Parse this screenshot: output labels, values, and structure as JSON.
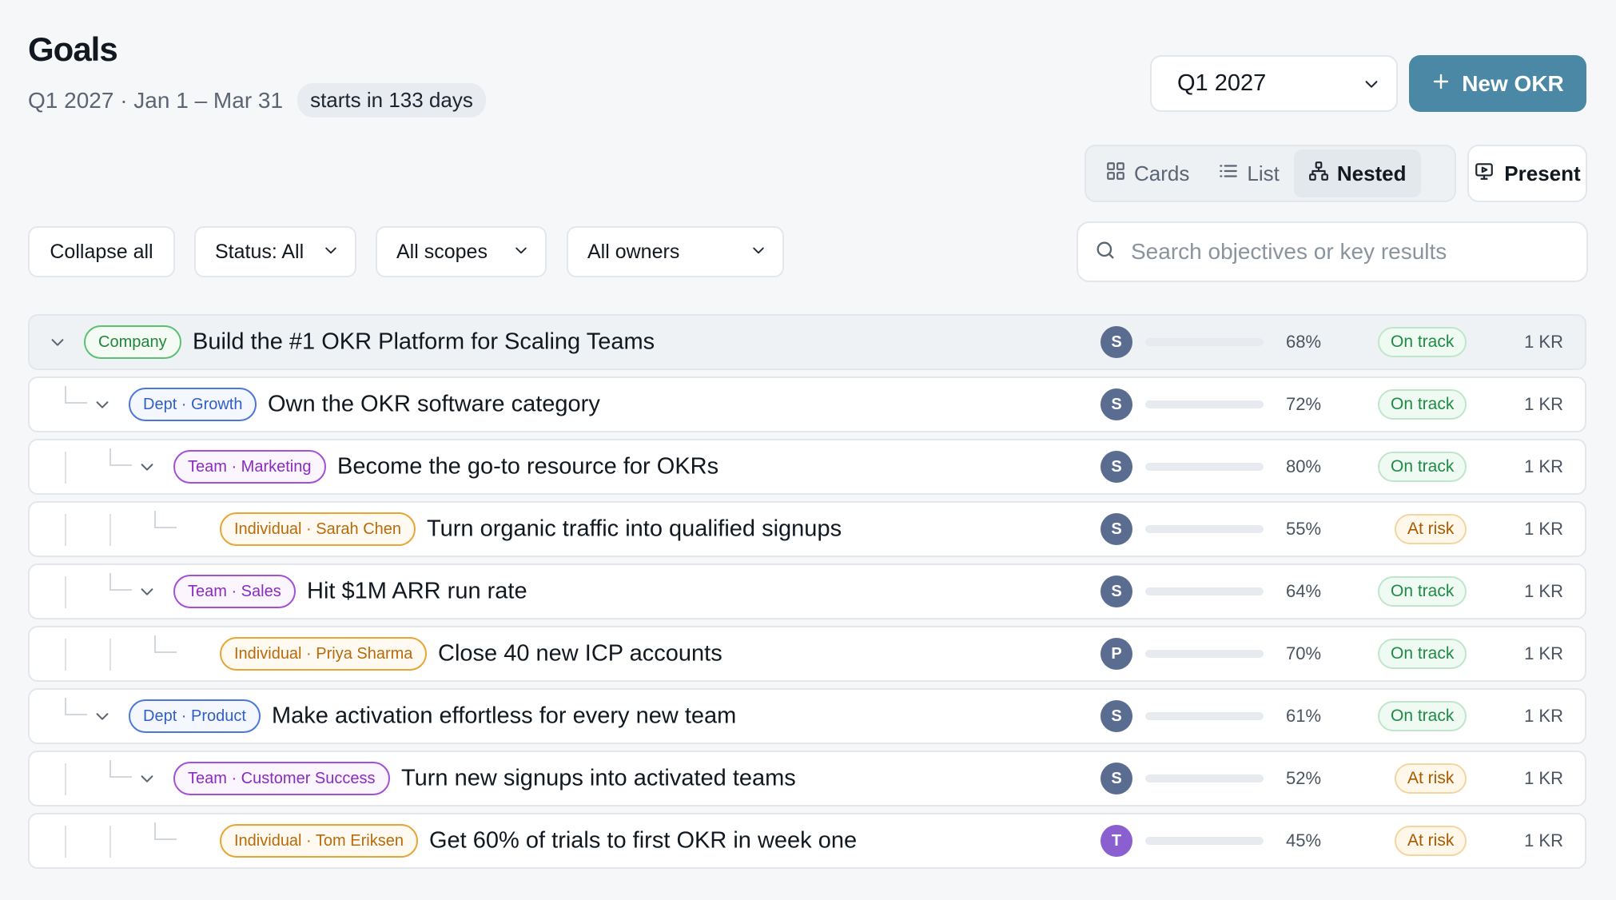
{
  "header": {
    "title": "Goals",
    "range": "Q1 2027 · Jan 1 – Mar 31",
    "countdown": "starts in 133 days",
    "quarter": "Q1 2027",
    "new_okr_label": "New OKR"
  },
  "views": {
    "cards": "Cards",
    "list": "List",
    "nested": "Nested",
    "active": "Nested",
    "present": "Present"
  },
  "filters": {
    "collapse": "Collapse all",
    "status": "Status: All",
    "scope": "All scopes",
    "owner": "All owners",
    "search_placeholder": "Search objectives or key results"
  },
  "colors": {
    "accent": "#4a88a6",
    "on_track_bar": "#4ccb8c",
    "at_risk_bar": "#f4bd1e"
  },
  "rows": [
    {
      "level": 0,
      "tag": "Company",
      "title": "Build the #1 OKR Platform for Scaling Teams",
      "owner_initial": "S",
      "progress": 0.68,
      "percent": "68%",
      "status": "On track",
      "kr": "1 KR"
    },
    {
      "level": 1,
      "tag": "Dept · Growth",
      "title": "Own the OKR software category",
      "owner_initial": "S",
      "progress": 0.72,
      "percent": "72%",
      "status": "On track",
      "kr": "1 KR"
    },
    {
      "level": 2,
      "tag": "Team · Marketing",
      "title": "Become the go-to resource for OKRs",
      "owner_initial": "S",
      "progress": 0.8,
      "percent": "80%",
      "status": "On track",
      "kr": "1 KR"
    },
    {
      "level": 3,
      "tag": "Individual · Sarah Chen",
      "title": "Turn organic traffic into qualified signups",
      "owner_initial": "S",
      "progress": 0.55,
      "percent": "55%",
      "status": "At risk",
      "kr": "1 KR"
    },
    {
      "level": 2,
      "tag": "Team · Sales",
      "title": "Hit $1M ARR run rate",
      "owner_initial": "S",
      "progress": 0.64,
      "percent": "64%",
      "status": "On track",
      "kr": "1 KR"
    },
    {
      "level": 3,
      "tag": "Individual · Priya Sharma",
      "title": "Close 40 new ICP accounts",
      "owner_initial": "P",
      "progress": 0.7,
      "percent": "70%",
      "status": "On track",
      "kr": "1 KR"
    },
    {
      "level": 1,
      "tag": "Dept · Product",
      "title": "Make activation effortless for every new team",
      "owner_initial": "S",
      "progress": 0.61,
      "percent": "61%",
      "status": "On track",
      "kr": "1 KR"
    },
    {
      "level": 2,
      "tag": "Team · Customer Success",
      "title": "Turn new signups into activated teams",
      "owner_initial": "S",
      "progress": 0.52,
      "percent": "52%",
      "status": "At risk",
      "kr": "1 KR"
    },
    {
      "level": 3,
      "tag": "Individual · Tom Eriksen",
      "title": "Get 60% of trials to first OKR in week one",
      "owner_initial": "T",
      "progress": 0.45,
      "percent": "45%",
      "status": "At risk",
      "kr": "1 KR"
    }
  ]
}
